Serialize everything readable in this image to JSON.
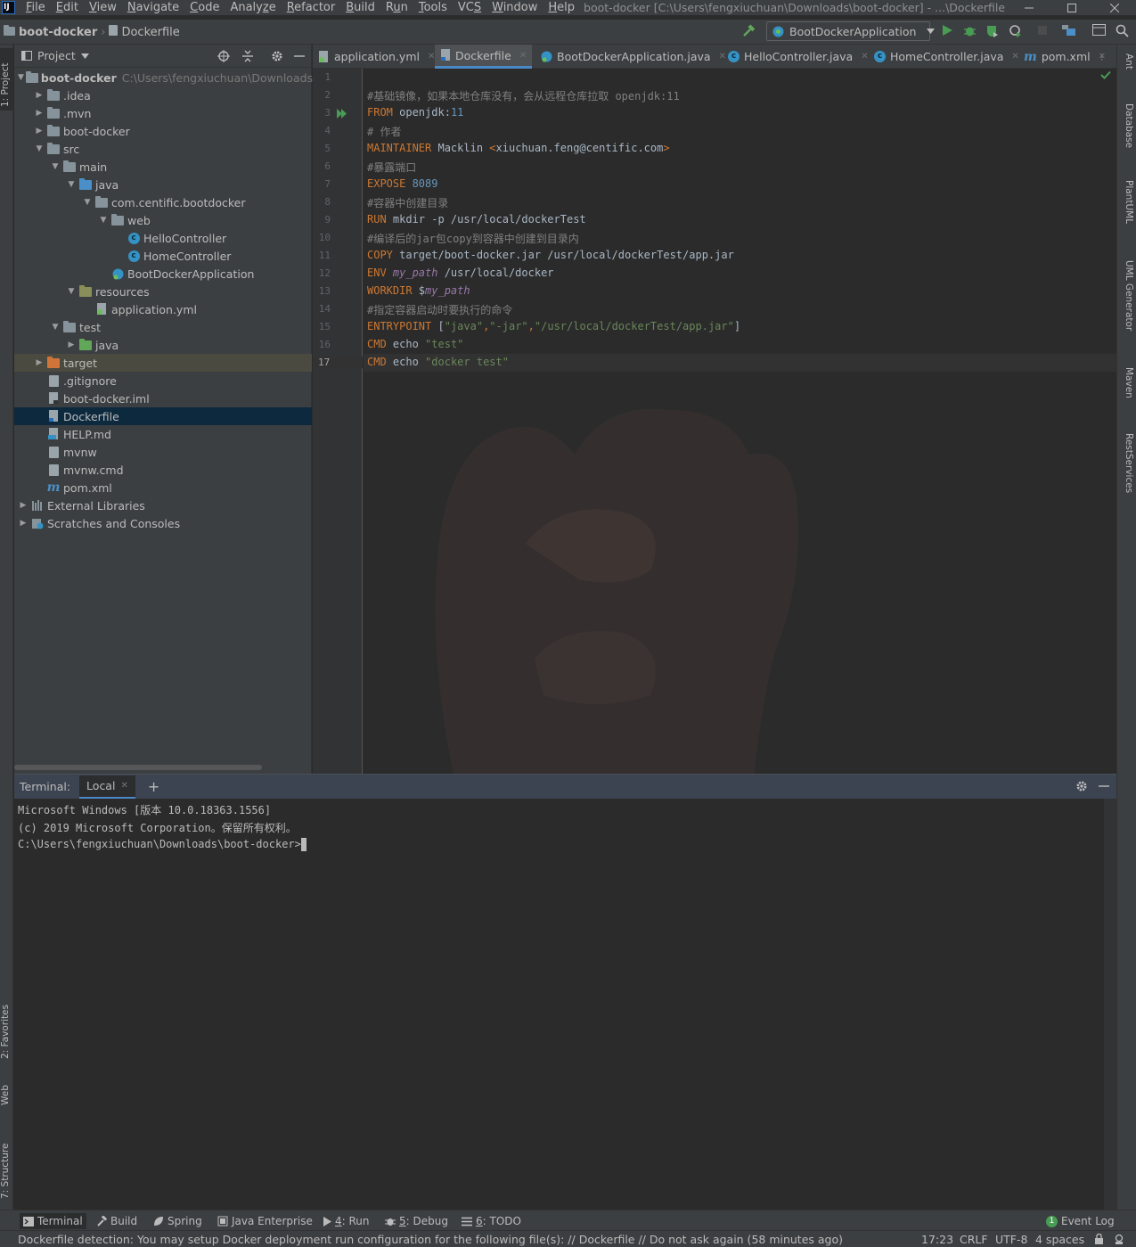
{
  "window": {
    "app_icon_text": "IJ",
    "title": "boot-docker [C:\\Users\\fengxiuchuan\\Downloads\\boot-docker] - ...\\Dockerfile",
    "menu": [
      {
        "mn": "F",
        "rest": "ile"
      },
      {
        "mn": "E",
        "rest": "dit"
      },
      {
        "mn": "V",
        "rest": "iew"
      },
      {
        "mn": "N",
        "rest": "avigate"
      },
      {
        "mn": "C",
        "rest": "ode"
      },
      {
        "pre": "Analy",
        "mn": "z",
        "rest": "e"
      },
      {
        "mn": "R",
        "rest": "efactor"
      },
      {
        "mn": "B",
        "rest": "uild"
      },
      {
        "pre": "R",
        "mn": "u",
        "rest": "n"
      },
      {
        "mn": "T",
        "rest": "ools"
      },
      {
        "pre": "VC",
        "mn": "S",
        "rest": ""
      },
      {
        "mn": "W",
        "rest": "indow"
      },
      {
        "mn": "H",
        "rest": "elp"
      }
    ]
  },
  "navbar": {
    "crumb_project": "boot-docker",
    "crumb_file": "Dockerfile",
    "run_config": "BootDockerApplication"
  },
  "left_strip": {
    "project": "1: Project",
    "favorites": "2: Favorites",
    "web": "Web",
    "structure": "7: Structure"
  },
  "right_strip": [
    "Ant",
    "Database",
    "PlantUML",
    "UML Generator",
    "Maven",
    "RestServices"
  ],
  "project": {
    "header": "Project",
    "tree": [
      {
        "label": "boot-docker",
        "path": "C:\\Users\\fengxiuchuan\\Downloads\\b",
        "bold": true
      },
      {
        "label": ".idea"
      },
      {
        "label": ".mvn"
      },
      {
        "label": "boot-docker"
      },
      {
        "label": "src"
      },
      {
        "label": "main"
      },
      {
        "label": "java"
      },
      {
        "label": "com.centific.bootdocker"
      },
      {
        "label": "web"
      },
      {
        "label": "HelloController"
      },
      {
        "label": "HomeController"
      },
      {
        "label": "BootDockerApplication"
      },
      {
        "label": "resources"
      },
      {
        "label": "application.yml"
      },
      {
        "label": "test"
      },
      {
        "label": "java"
      },
      {
        "label": "target"
      },
      {
        "label": ".gitignore"
      },
      {
        "label": "boot-docker.iml"
      },
      {
        "label": "Dockerfile"
      },
      {
        "label": "HELP.md"
      },
      {
        "label": "mvnw"
      },
      {
        "label": "mvnw.cmd"
      },
      {
        "label": "pom.xml"
      },
      {
        "label": "External Libraries"
      },
      {
        "label": "Scratches and Consoles"
      }
    ]
  },
  "tabs": [
    "application.yml",
    "Dockerfile",
    "BootDockerApplication.java",
    "HelloController.java",
    "HomeController.java",
    "pom.xml"
  ],
  "editor": {
    "line_numbers": [
      "1",
      "2",
      "3",
      "4",
      "5",
      "6",
      "7",
      "8",
      "9",
      "10",
      "11",
      "12",
      "13",
      "14",
      "15",
      "16",
      "17"
    ],
    "l2": "#基础镜像，如果本地仓库没有，会从远程仓库拉取 openjdk:11",
    "l3": {
      "kw": "FROM",
      "rest": " openjdk:",
      "num": "11"
    },
    "l4": "# 作者",
    "l5": {
      "kw": "MAINTAINER",
      "rest": " Macklin ",
      "lt": "<",
      "email": "xiuchuan.feng@centific.com",
      "gt": ">"
    },
    "l6": "#暴露端口",
    "l7": {
      "kw": "EXPOSE",
      "num": " 8089"
    },
    "l8": "#容器中创建目录",
    "l9": {
      "kw": "RUN",
      "rest": " mkdir -p /usr/local/dockerTest"
    },
    "l10": "#编译后的jar包copy到容器中创建到目录内",
    "l11": {
      "kw": "COPY",
      "rest": " target/boot-docker.jar /usr/local/dockerTest/app.jar"
    },
    "l12": {
      "kw": "ENV",
      "var": " my_path",
      "rest": " /usr/local/docker"
    },
    "l13": {
      "kw": "WORKDIR",
      "rest": " $",
      "var": "my_path"
    },
    "l14": "#指定容器启动时要执行的命令",
    "l15": {
      "kw": "ENTRYPOINT",
      "open": " [",
      "s1": "\"java\"",
      "c1": ",",
      "s2": "\"-jar\"",
      "c2": ",",
      "s3": "\"/usr/local/dockerTest/app.jar\"",
      "close": "]"
    },
    "l16": {
      "kw": "CMD",
      "rest": " echo ",
      "str": "\"test\""
    },
    "l17": {
      "kw": "CMD",
      "rest": " echo ",
      "str": "\"docker test\""
    }
  },
  "terminal": {
    "label": "Terminal:",
    "tab": "Local",
    "lines": [
      "Microsoft Windows [版本 10.0.18363.1556]",
      "(c) 2019 Microsoft Corporation。保留所有权利。",
      "C:\\Users\\fengxiuchuan\\Downloads\\boot-docker>"
    ]
  },
  "tooltabs": {
    "terminal": "Terminal",
    "build": "Build",
    "spring": "Spring",
    "java_ee": "Java Enterprise",
    "run_num": "4",
    "run": ": Run",
    "debug_num": "5",
    "debug": ": Debug",
    "todo_num": "6",
    "todo": ": TODO",
    "event_log": "Event Log",
    "event_count": "1"
  },
  "status": {
    "message": "Dockerfile detection: You may setup Docker deployment run configuration for the following file(s): // Dockerfile // Do not ask again (58 minutes ago)",
    "position": "17:23",
    "line_sep": "CRLF",
    "encoding": "UTF-8",
    "indent": "4 spaces"
  },
  "colors": {
    "keyword": "#cc7832",
    "comment": "#808080",
    "number": "#6897bb",
    "string": "#6a8759",
    "variable": "#9876aa",
    "selection": "#0d293e"
  }
}
